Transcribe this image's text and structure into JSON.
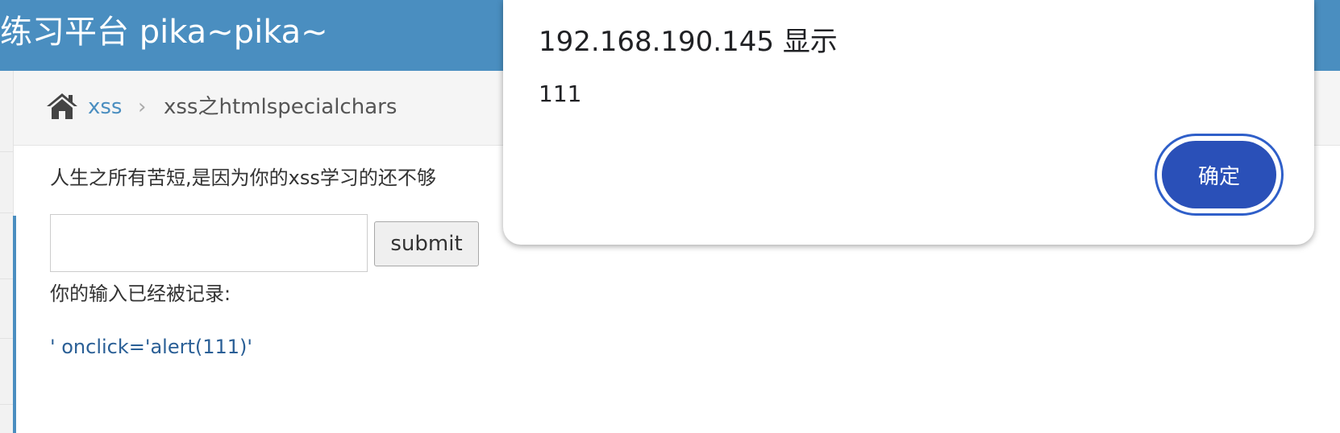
{
  "header": {
    "title": "练习平台 pika~pika~"
  },
  "breadcrumb": {
    "home_icon": "home-icon",
    "link": "xss",
    "separator": "›",
    "current": "xss之htmlspecialchars"
  },
  "main": {
    "intro": "人生之所有苦短,是因为你的xss学习的还不够",
    "input": {
      "value": "",
      "placeholder": ""
    },
    "submit_label": "submit",
    "recorded_label": "你的输入已经被记录:",
    "recorded_value": "' onclick='alert(111)'"
  },
  "dialog": {
    "title": "192.168.190.145 显示",
    "message": "111",
    "ok_label": "确定"
  },
  "colors": {
    "header_bg": "#4a8ec0",
    "link": "#4a8ec0",
    "recorded_value": "#2a5f96",
    "dialog_button": "#2a50b8"
  }
}
